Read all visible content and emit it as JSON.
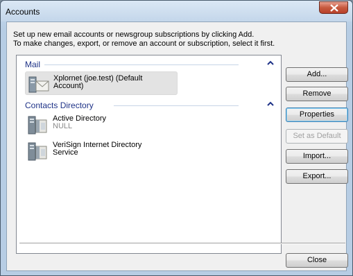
{
  "window": {
    "title": "Accounts"
  },
  "intro": {
    "line1": "Set up new email accounts or newsgroup subscriptions by clicking Add.",
    "line2": "To make changes, export, or remove an account or subscription, select it first."
  },
  "groups": [
    {
      "label": "Mail",
      "items": [
        {
          "line1": "Xplornet (joe.test) (Default",
          "line2": "Account)",
          "icon": "mail-account-icon",
          "selected": true
        }
      ]
    },
    {
      "label": "Contacts Directory",
      "items": [
        {
          "line1": "Active Directory",
          "line2": "NULL",
          "icon": "directory-service-icon"
        },
        {
          "line1": "VeriSign Internet Directory",
          "line2": "Service",
          "icon": "directory-service-icon"
        }
      ]
    }
  ],
  "buttons": {
    "add": "Add...",
    "remove": "Remove",
    "properties": "Properties",
    "set_default": "Set as Default",
    "import": "Import...",
    "export": "Export...",
    "close": "Close"
  }
}
